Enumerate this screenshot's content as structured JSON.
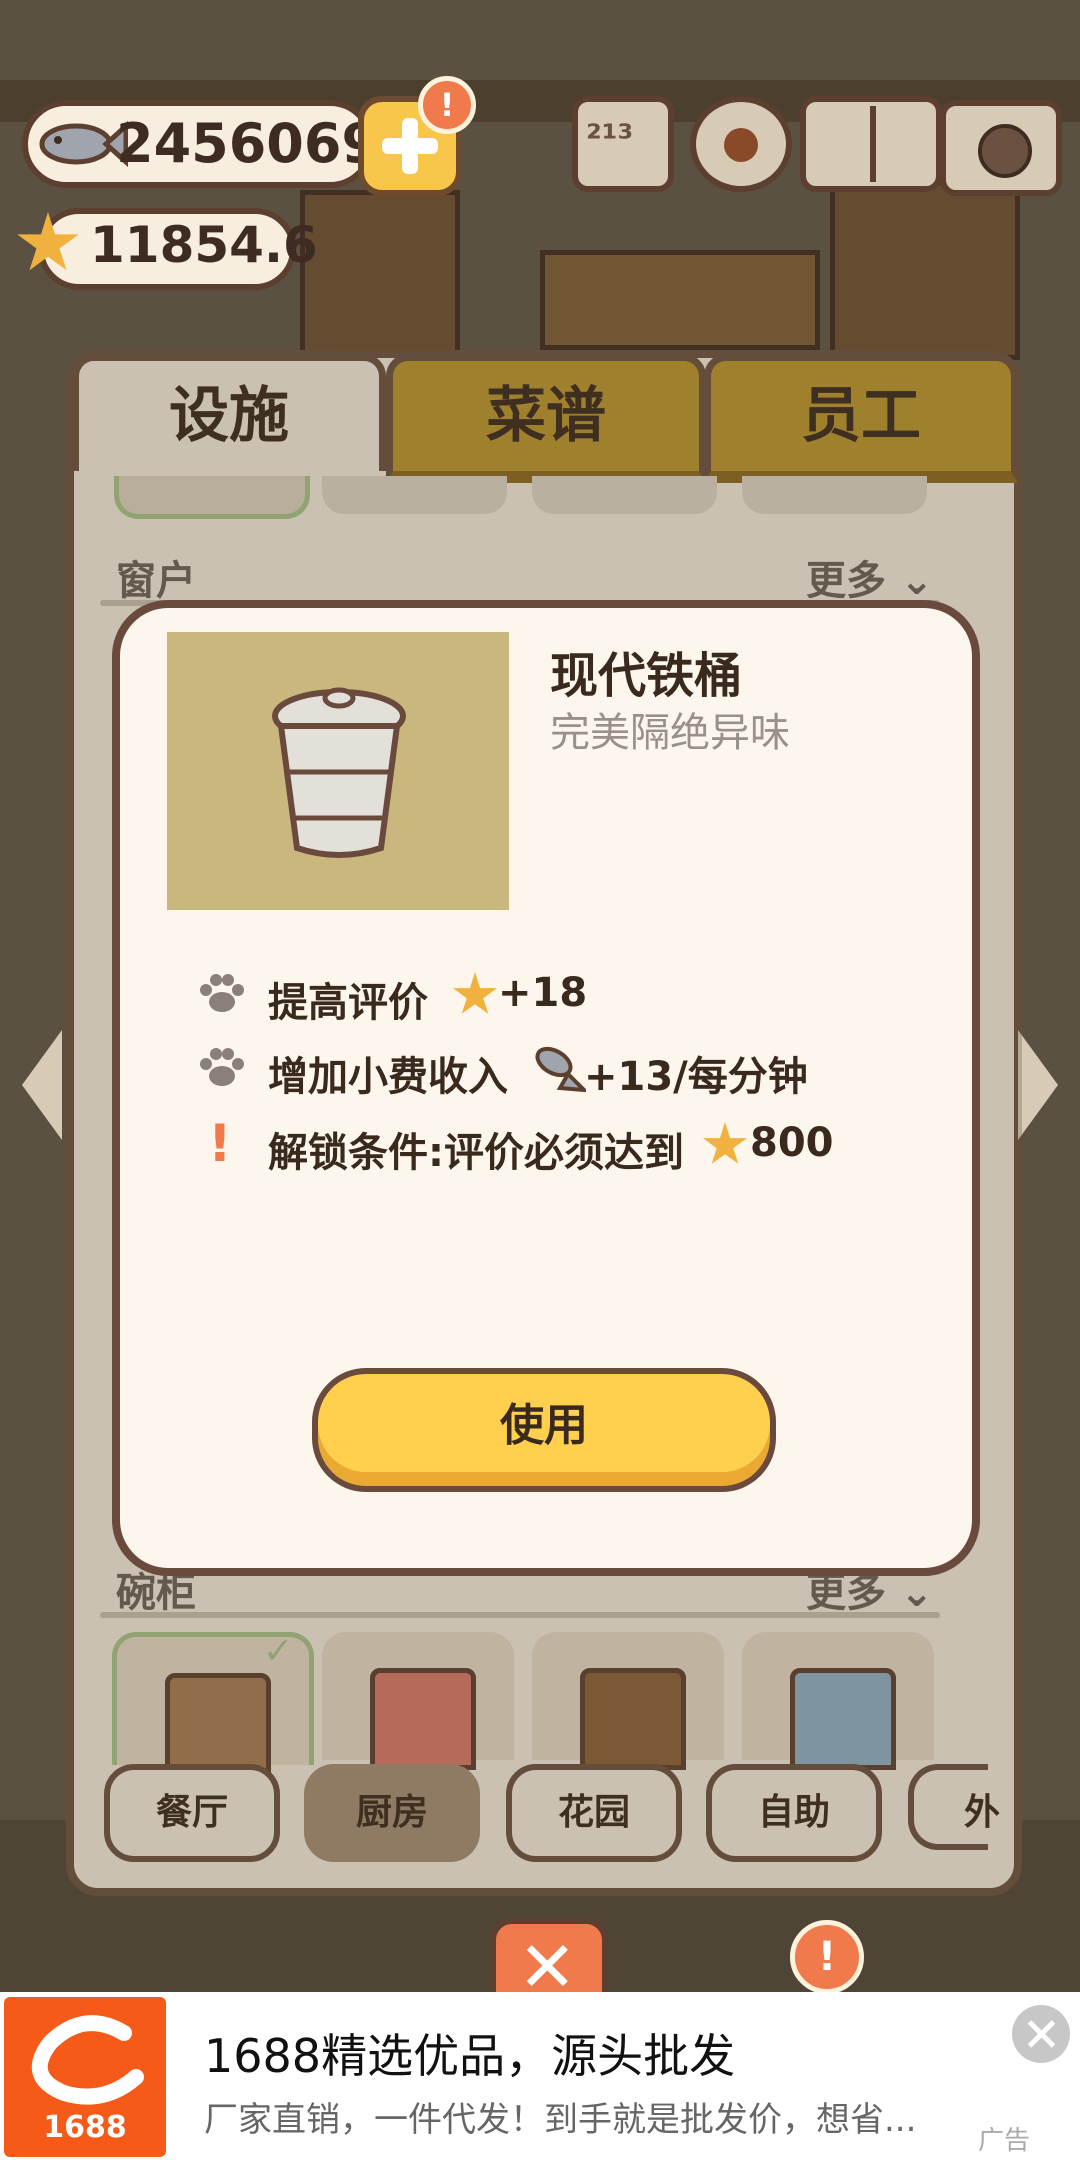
{
  "hud": {
    "fish_currency": "2456069",
    "star_rating": "11854.6",
    "alert_badge": "!",
    "icons": [
      "rank-icon",
      "settings-gear-icon",
      "cat-book-icon",
      "camera-icon"
    ]
  },
  "panel": {
    "tabs": [
      {
        "label": "设施",
        "active": true
      },
      {
        "label": "菜谱",
        "active": false
      },
      {
        "label": "员工",
        "active": false
      }
    ],
    "sections": [
      {
        "label": "窗户",
        "more": "更多"
      },
      {
        "label": "碗柜",
        "more": "更多"
      }
    ],
    "bottom_tabs": [
      {
        "label": "餐厅",
        "active": false
      },
      {
        "label": "厨房",
        "active": true
      },
      {
        "label": "花园",
        "active": false
      },
      {
        "label": "自助",
        "active": false
      },
      {
        "label": "外",
        "active": false
      }
    ]
  },
  "modal": {
    "title": "现代铁桶",
    "subtitle": "完美隔绝异味",
    "attributes": [
      {
        "label": "提高评价",
        "value": "+18",
        "icon": "star-icon"
      },
      {
        "label": "增加小费收入",
        "value": "+13/每分钟",
        "icon": "fish-icon"
      }
    ],
    "unlock": {
      "label": "解锁条件:评价必须达到",
      "value": "800",
      "icon": "star-icon"
    },
    "use_button": "使用"
  },
  "ad": {
    "logo_text": "1688",
    "title": "1688精选优品，源头批发",
    "description": "厂家直销，一件代发！到手就是批发价，想省...",
    "tag": "广告"
  },
  "colors": {
    "accent_yellow": "#ffd04d",
    "panel_border": "#6b5240",
    "ad_brand": "#f55a19",
    "star": "#f0b13e"
  }
}
